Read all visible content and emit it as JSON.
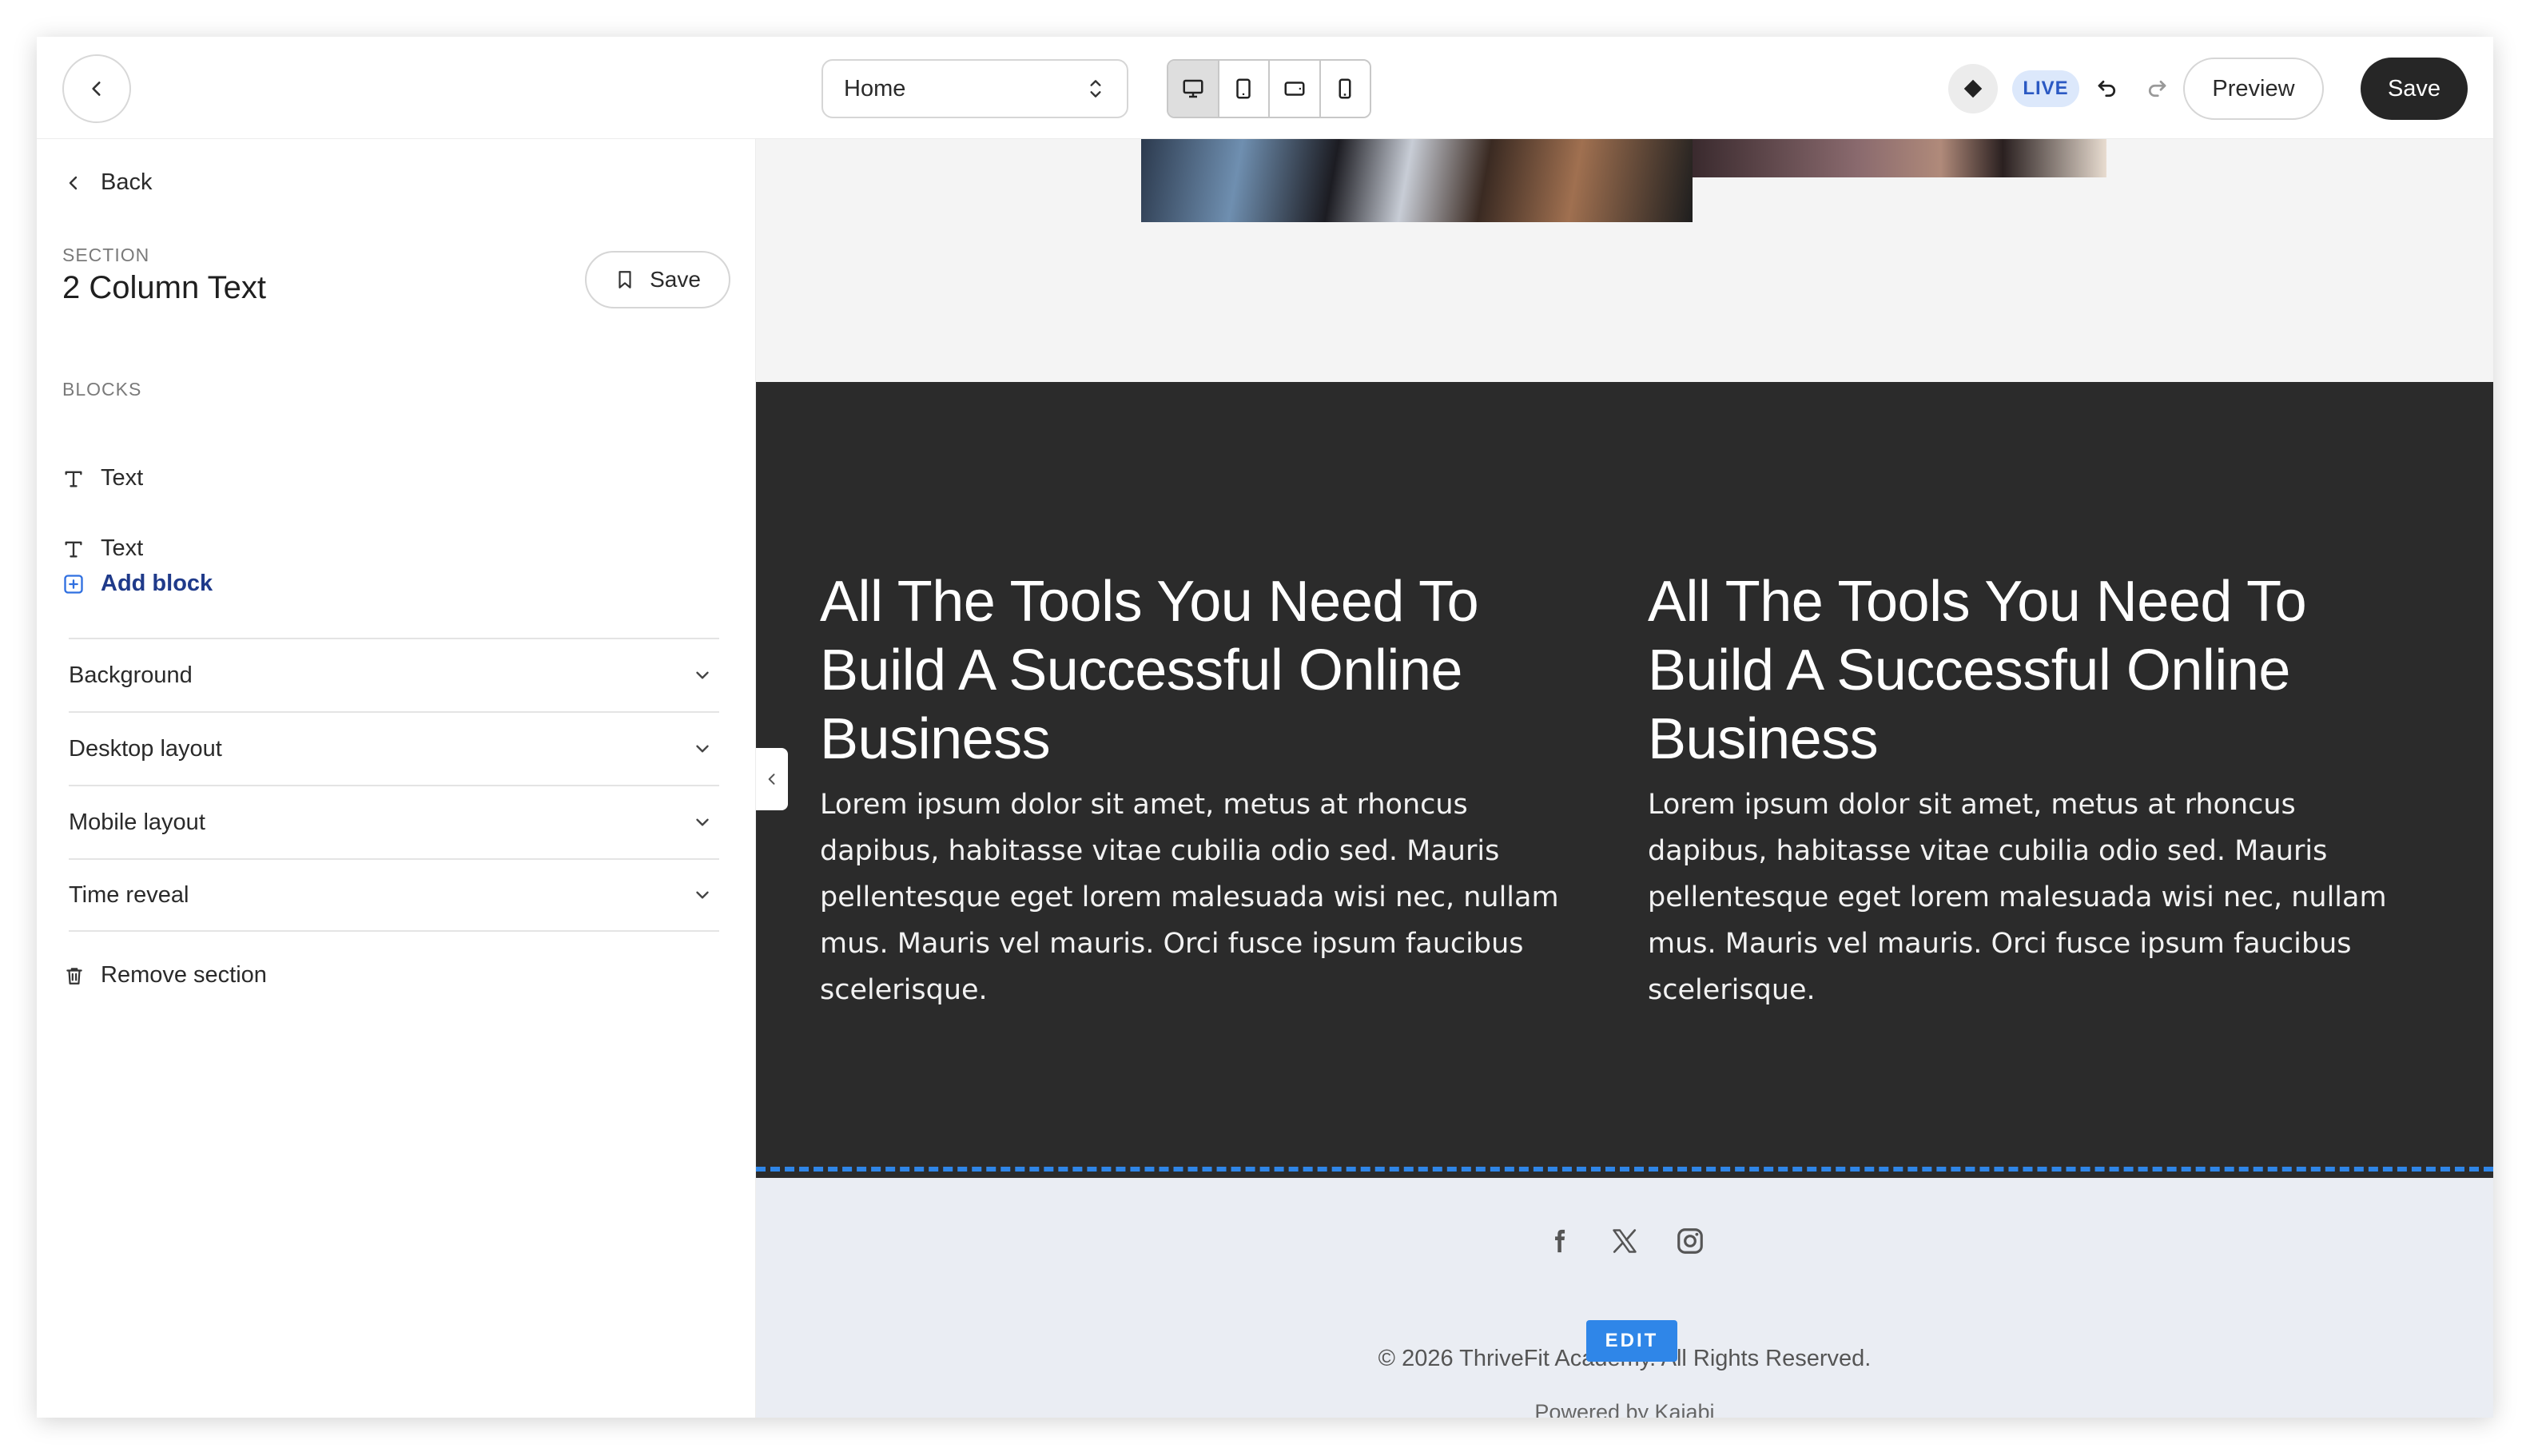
{
  "topbar": {
    "page_select": "Home",
    "live_label": "LIVE",
    "preview_label": "Preview",
    "save_label": "Save",
    "device_modes": [
      "desktop",
      "tablet-portrait",
      "tablet-landscape",
      "mobile"
    ],
    "active_device": "desktop"
  },
  "sidebar": {
    "back_label": "Back",
    "section_kicker": "SECTION",
    "section_title": "2 Column Text",
    "save_label": "Save",
    "blocks_kicker": "BLOCKS",
    "blocks": [
      {
        "label": "Text",
        "icon": "text-type-icon"
      },
      {
        "label": "Text",
        "icon": "text-type-icon"
      }
    ],
    "add_block_label": "Add block",
    "accordions": [
      {
        "label": "Background"
      },
      {
        "label": "Desktop layout"
      },
      {
        "label": "Mobile layout"
      },
      {
        "label": "Time reveal"
      }
    ],
    "remove_section_label": "Remove section"
  },
  "canvas": {
    "columns": [
      {
        "heading": "All The Tools You Need To Build A Successful Online Business",
        "body": "Lorem ipsum dolor sit amet, metus at rhoncus dapibus, habitasse vitae cubilia odio sed. Mauris pellentesque eget lorem malesuada wisi nec, nullam mus. Mauris vel mauris. Orci fusce ipsum faucibus scelerisque."
      },
      {
        "heading": "All The Tools You Need To Build A Successful Online Business",
        "body": "Lorem ipsum dolor sit amet, metus at rhoncus dapibus, habitasse vitae cubilia odio sed. Mauris pellentesque eget lorem malesuada wisi nec, nullam mus. Mauris vel mauris. Orci fusce ipsum faucibus scelerisque."
      }
    ],
    "footer": {
      "socials": [
        "facebook-icon",
        "x-icon",
        "instagram-icon"
      ],
      "edit_label": "EDIT",
      "copyright": "© 2026 ThriveFit Academy. All Rights Reserved.",
      "powered_by": "Powered by Kajabi"
    }
  },
  "colors": {
    "dark_section": "#2b2b2b",
    "accent_blue": "#2f86e8",
    "live_badge_bg": "#dce8fb",
    "live_badge_text": "#2b59c3",
    "primary_button": "#262626"
  }
}
